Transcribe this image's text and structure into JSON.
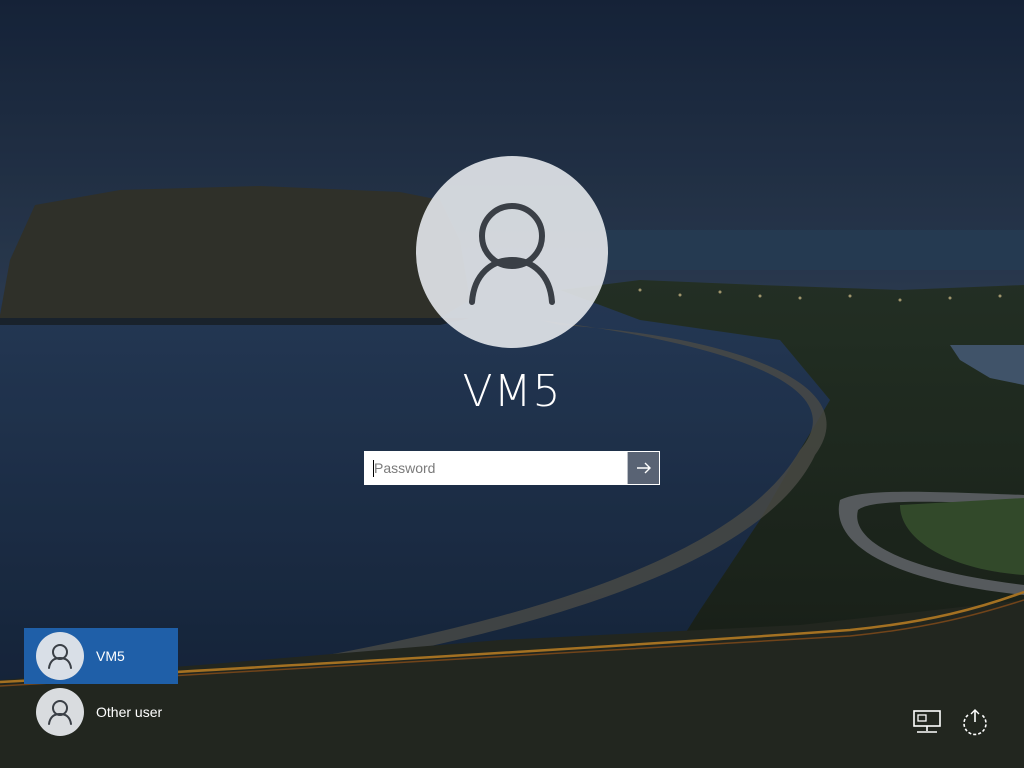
{
  "login": {
    "username": "VM5",
    "password_placeholder": "Password"
  },
  "user_list": [
    {
      "name": "VM5",
      "selected": true
    },
    {
      "name": "Other user",
      "selected": false
    }
  ],
  "system_icons": [
    "network-icon",
    "power-icon"
  ],
  "colors": {
    "selected_user_bg": "#1f5fa8",
    "avatar_circle": "#e1e4e8",
    "text": "#ffffff"
  }
}
